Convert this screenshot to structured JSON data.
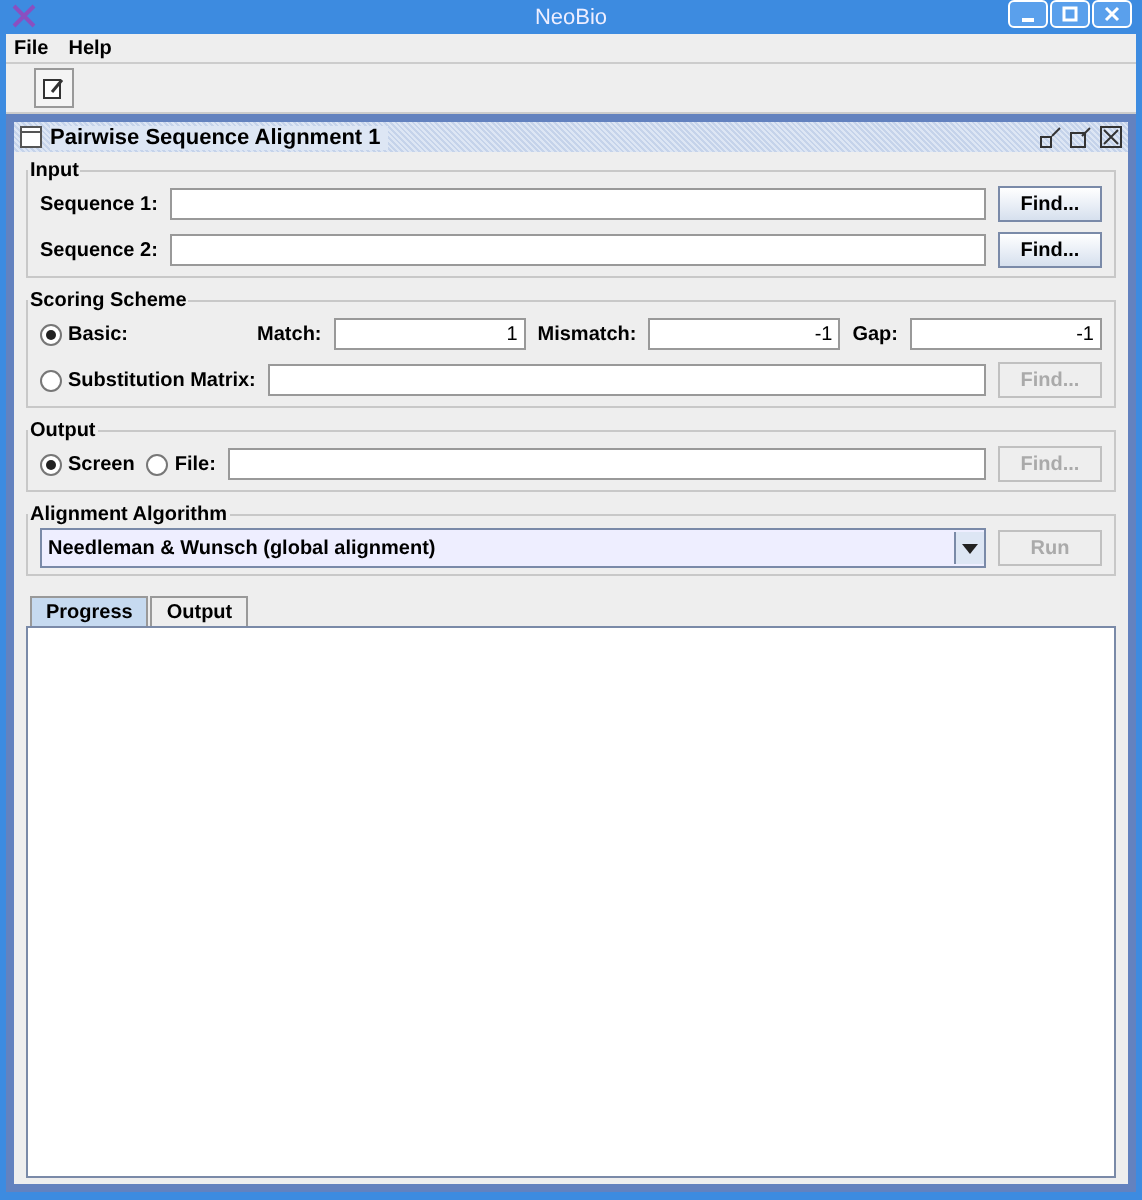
{
  "window": {
    "title": "NeoBio"
  },
  "menu": [
    {
      "label": "File"
    },
    {
      "label": "Help"
    }
  ],
  "frame": {
    "title": "Pairwise Sequence Alignment 1"
  },
  "input": {
    "title": "Input",
    "rows": [
      {
        "label": "Sequence 1:",
        "button": "Find...",
        "disabled": false
      },
      {
        "label": "Sequence 2:",
        "button": "Find...",
        "disabled": false
      }
    ]
  },
  "scoring": {
    "title": "Scoring Scheme",
    "basic": {
      "label": "Basic:",
      "selected": true
    },
    "fields": [
      {
        "label": "Match:",
        "value": "1"
      },
      {
        "label": "Mismatch:",
        "value": "-1"
      },
      {
        "label": "Gap:",
        "value": "-1"
      }
    ],
    "matrix": {
      "label": "Substitution Matrix:",
      "selected": false,
      "button": "Find...",
      "disabled": true
    }
  },
  "output": {
    "title": "Output",
    "options": [
      {
        "label": "Screen",
        "selected": true
      },
      {
        "label": "File:",
        "selected": false
      }
    ],
    "button": "Find...",
    "disabled": true
  },
  "algorithm": {
    "title": "Alignment Algorithm",
    "value": "Needleman & Wunsch (global alignment)",
    "button": "Run",
    "disabled": true
  },
  "tabs": [
    {
      "label": "Progress",
      "selected": true
    },
    {
      "label": "Output",
      "selected": false
    }
  ]
}
